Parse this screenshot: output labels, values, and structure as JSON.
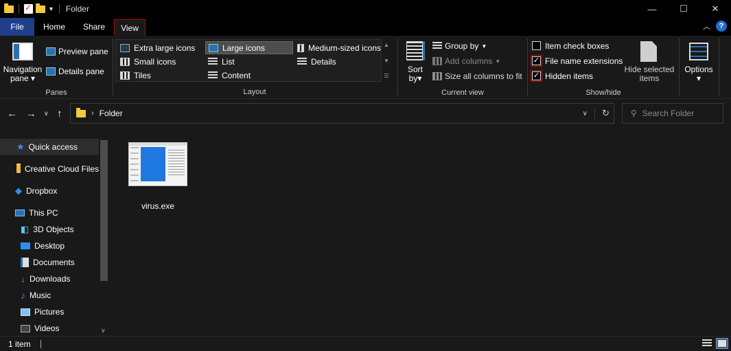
{
  "window": {
    "title": "Folder",
    "controls": [
      "—",
      "☐",
      "✕"
    ]
  },
  "menu": {
    "file": "File",
    "home": "Home",
    "share": "Share",
    "view": "View"
  },
  "ribbon": {
    "panes": {
      "group_label": "Panes",
      "navigation_pane_line1": "Navigation",
      "navigation_pane_line2": "pane",
      "preview_pane": "Preview pane",
      "details_pane": "Details pane"
    },
    "layout": {
      "group_label": "Layout",
      "extra_large_icons": "Extra large icons",
      "large_icons": "Large icons",
      "medium_icons": "Medium-sized icons",
      "small_icons": "Small icons",
      "list": "List",
      "details": "Details",
      "tiles": "Tiles",
      "content": "Content",
      "selected": "Large icons"
    },
    "current_view": {
      "group_label": "Current view",
      "sort_by_line1": "Sort",
      "sort_by_line2": "by",
      "group_by": "Group by",
      "add_columns": "Add columns",
      "size_all_columns": "Size all columns to fit"
    },
    "show_hide": {
      "group_label": "Show/hide",
      "item_check_boxes": "Item check boxes",
      "item_check_boxes_checked": false,
      "file_name_extensions": "File name extensions",
      "file_name_extensions_checked": true,
      "hidden_items": "Hidden items",
      "hidden_items_checked": true,
      "hide_selected_line1": "Hide selected",
      "hide_selected_line2": "items"
    },
    "options": {
      "label": "Options"
    }
  },
  "address": {
    "path": "Folder",
    "search_placeholder": "Search Folder"
  },
  "nav_pane": {
    "items": [
      {
        "label": "Quick access",
        "icon": "star-icon",
        "active": true
      },
      {
        "label": "Creative Cloud Files",
        "icon": "creative-cloud-icon"
      },
      {
        "label": "Dropbox",
        "icon": "dropbox-icon"
      },
      {
        "label": "This PC",
        "icon": "pc-icon"
      },
      {
        "label": "3D Objects",
        "icon": "cube-icon"
      },
      {
        "label": "Desktop",
        "icon": "desktop-icon"
      },
      {
        "label": "Documents",
        "icon": "documents-icon"
      },
      {
        "label": "Downloads",
        "icon": "download-icon"
      },
      {
        "label": "Music",
        "icon": "music-icon"
      },
      {
        "label": "Pictures",
        "icon": "pictures-icon"
      },
      {
        "label": "Videos",
        "icon": "videos-icon"
      }
    ]
  },
  "content": {
    "files": [
      {
        "name": "virus.exe"
      }
    ]
  },
  "status": {
    "item_count": "1 item"
  },
  "colors": {
    "accent": "#1f3f8b",
    "highlight_border": "#c00000",
    "background": "#191919"
  }
}
